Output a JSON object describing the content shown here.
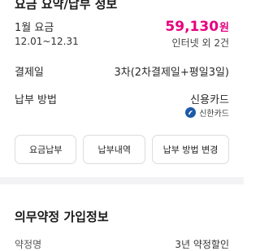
{
  "header": {
    "title": "요금 요약/납부 정보"
  },
  "bill": {
    "month_label": "1월 요금",
    "amount": "59,130",
    "amount_unit": "원",
    "period": "12.01~12.31",
    "services_note": "인터넷 외 2건"
  },
  "payment_date": {
    "label": "결제일",
    "value": "3차(2차결제일+평일3일)"
  },
  "payment_method": {
    "label": "납부 방법",
    "value": "신용카드",
    "card_issuer": "신한카드",
    "card_icon": "shinhan-card-logo-icon",
    "card_color": "#1d5aa8"
  },
  "buttons": {
    "pay_bill": "요금납부",
    "payment_history": "납부내역",
    "change_method": "납부 방법 변경"
  },
  "contract_section": {
    "title": "의무약정 가입정보",
    "row_label": "약정명",
    "row_value": "3년 약정할인"
  },
  "colors": {
    "accent": "#e6007e",
    "divider": "#f3f3f5"
  }
}
